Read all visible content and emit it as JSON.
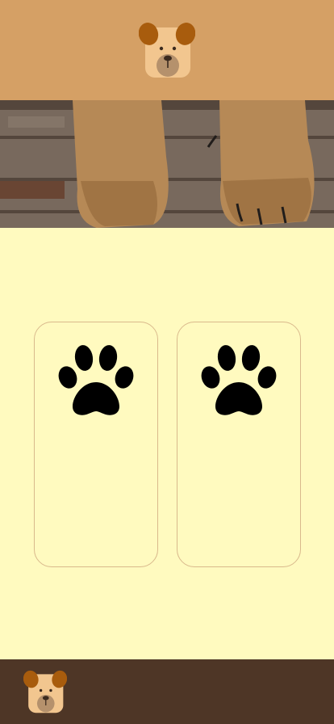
{
  "colors": {
    "header_bg": "#D5A065",
    "hero_overlay": "#3A2A1E",
    "main_bg": "#FFFABF",
    "card_border": "#D9B98C",
    "footer_bg": "#4E3626",
    "logo_face": "#F2C68F",
    "logo_ears": "#A85C0D",
    "logo_muzzle": "#B5916C",
    "paw_color": "#000000",
    "wood_light": "#8A7C6F",
    "wood_dark": "#5C4F44",
    "fur_light": "#D9A566",
    "fur_dark": "#9C6A32"
  },
  "header": {
    "logo_icon": "dog-face-icon"
  },
  "hero": {
    "image": "dog-paws-on-wood-photo"
  },
  "cards": [
    {
      "icon": "paw-icon"
    },
    {
      "icon": "paw-icon"
    }
  ],
  "footer": {
    "logo_icon": "dog-face-icon"
  }
}
